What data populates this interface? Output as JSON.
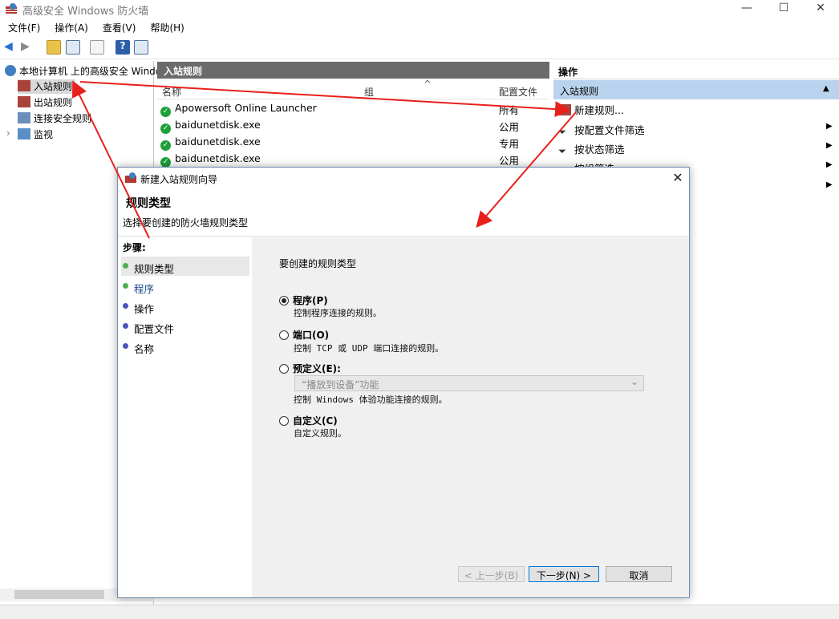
{
  "window": {
    "title": "高级安全 Windows 防火墙",
    "controls": {
      "minimize": "—",
      "maximize": "☐",
      "close": "✕"
    }
  },
  "menu": [
    "文件(F)",
    "操作(A)",
    "查看(V)",
    "帮助(H)"
  ],
  "toolbar": {
    "back": "◀",
    "forward": "▶",
    "help": "?"
  },
  "tree": {
    "root": "本地计算机 上的高级安全 Windows",
    "items": [
      "入站规则",
      "出站规则",
      "连接安全规则",
      "监视"
    ],
    "expander": "›"
  },
  "middle": {
    "header": "入站规则",
    "columns": {
      "name": "名称",
      "group": "组",
      "profile": "配置文件"
    },
    "sort_indicator": "^",
    "rows": [
      {
        "name": "Apowersoft Online Launcher",
        "profile": "所有"
      },
      {
        "name": "baidunetdisk.exe",
        "profile": "公用"
      },
      {
        "name": "baidunetdisk.exe",
        "profile": "专用"
      },
      {
        "name": "baidunetdisk.exe",
        "profile": "公用"
      }
    ],
    "check": "✓"
  },
  "actions": {
    "header": "操作",
    "section": "入站规则",
    "collapse": "▲",
    "items": [
      {
        "label": "新建规则...",
        "arrow": ""
      },
      {
        "label": "按配置文件筛选",
        "arrow": "▶"
      },
      {
        "label": "按状态筛选",
        "arrow": "▶"
      },
      {
        "label": "按组筛选",
        "arrow": "▶"
      },
      {
        "label": "",
        "arrow": "▶"
      }
    ]
  },
  "dialog": {
    "title": "新建入站规则向导",
    "close": "✕",
    "heading": "规则类型",
    "subheading": "选择要创建的防火墙规则类型",
    "steps_title": "步骤:",
    "steps": [
      "规则类型",
      "程序",
      "操作",
      "配置文件",
      "名称"
    ],
    "prompt": "要创建的规则类型",
    "options": [
      {
        "label": "程序(P)",
        "desc": "控制程序连接的规则。",
        "checked": true
      },
      {
        "label": "端口(O)",
        "desc": "控制 TCP 或 UDP 端口连接的规则。",
        "checked": false
      },
      {
        "label": "预定义(E):",
        "desc": "控制 Windows 体验功能连接的规则。",
        "checked": false
      },
      {
        "label": "自定义(C)",
        "desc": "自定义规则。",
        "checked": false
      }
    ],
    "predefined_select": "“播放到设备”功能",
    "select_arrow": "⌄",
    "buttons": {
      "back": "< 上一步(B)",
      "next": "下一步(N) >",
      "cancel": "取消"
    }
  },
  "colors": {
    "accent_arrow": "#e8201c",
    "selected_section": "#b9d3ee",
    "panel_header": "#6b6b6b",
    "step_done": "#4caf50",
    "step_pending": "#4a56b8"
  }
}
